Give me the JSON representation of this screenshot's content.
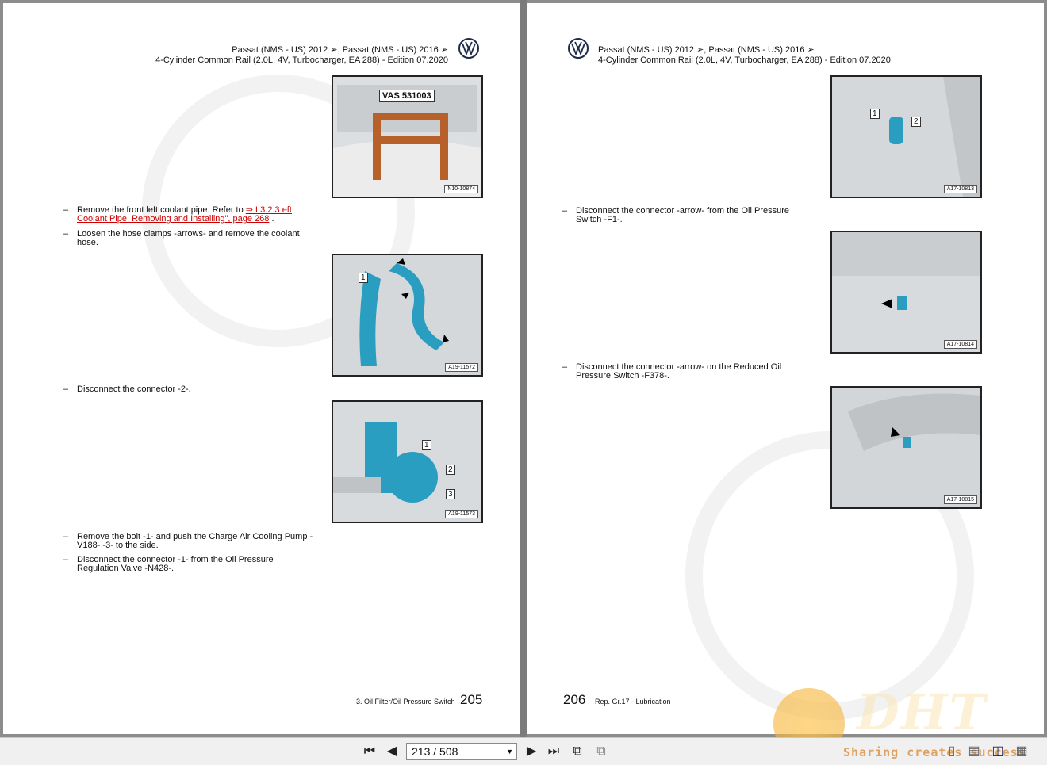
{
  "left_page": {
    "header_line1": "Passat (NMS - US) 2012 ➢, Passat (NMS - US) 2016 ➢",
    "header_line2": "4-Cylinder Common Rail (2.0L, 4V, Turbocharger, EA 288) - Edition 07.2020",
    "steps": [
      {
        "dash": "–",
        "text_before": "Remove the front left coolant pipe. Refer to ",
        "link": "⇒ L3.2.3 eft Coolant Pipe, Removing and Installing\", page 268",
        "text_after": " ."
      },
      {
        "dash": "–",
        "text": "Loosen the hose clamps -arrows- and remove the coolant hose."
      },
      {
        "dash": "–",
        "text": "Disconnect the connector -2-."
      },
      {
        "dash": "–",
        "text": "Remove the bolt -1- and push the Charge Air Cooling Pump -V188- -3- to the side."
      },
      {
        "dash": "–",
        "text": "Disconnect the connector -1- from the Oil Pressure Regulation Valve -N428-."
      }
    ],
    "figures": [
      {
        "code": "N10-10874",
        "label": "VAS 531003"
      },
      {
        "code": "A19-11572",
        "callouts": [
          "1"
        ]
      },
      {
        "code": "A19-11573",
        "callouts": [
          "1",
          "2",
          "3"
        ]
      }
    ],
    "footer_text": "3. Oil Filter/Oil Pressure Switch",
    "page_number": "205"
  },
  "right_page": {
    "header_line1": "Passat (NMS - US) 2012 ➢, Passat (NMS - US) 2016 ➢",
    "header_line2": "4-Cylinder Common Rail (2.0L, 4V, Turbocharger, EA 288) - Edition 07.2020",
    "steps": [
      {
        "dash": "–",
        "text": "Disconnect the connector -arrow- from the Oil Pressure Switch -F1-."
      },
      {
        "dash": "–",
        "text": "Disconnect the connector -arrow- on the Reduced Oil Pressure Switch -F378-."
      }
    ],
    "figures": [
      {
        "code": "A17-10813",
        "callouts": [
          "1",
          "2"
        ]
      },
      {
        "code": "A17-10814"
      },
      {
        "code": "A17-10815"
      }
    ],
    "footer_text": "Rep. Gr.17 - Lubrication",
    "page_number": "206"
  },
  "toolbar": {
    "page_field": "213 / 508",
    "icons": [
      "first-page-icon",
      "prev-page-icon",
      "next-page-icon",
      "last-page-icon",
      "two-page-icon",
      "fit-icon",
      "single-page-icon",
      "scroll-icon",
      "facing-icon",
      "continuous-icon"
    ]
  },
  "watermark_text": "Sharing creates success"
}
